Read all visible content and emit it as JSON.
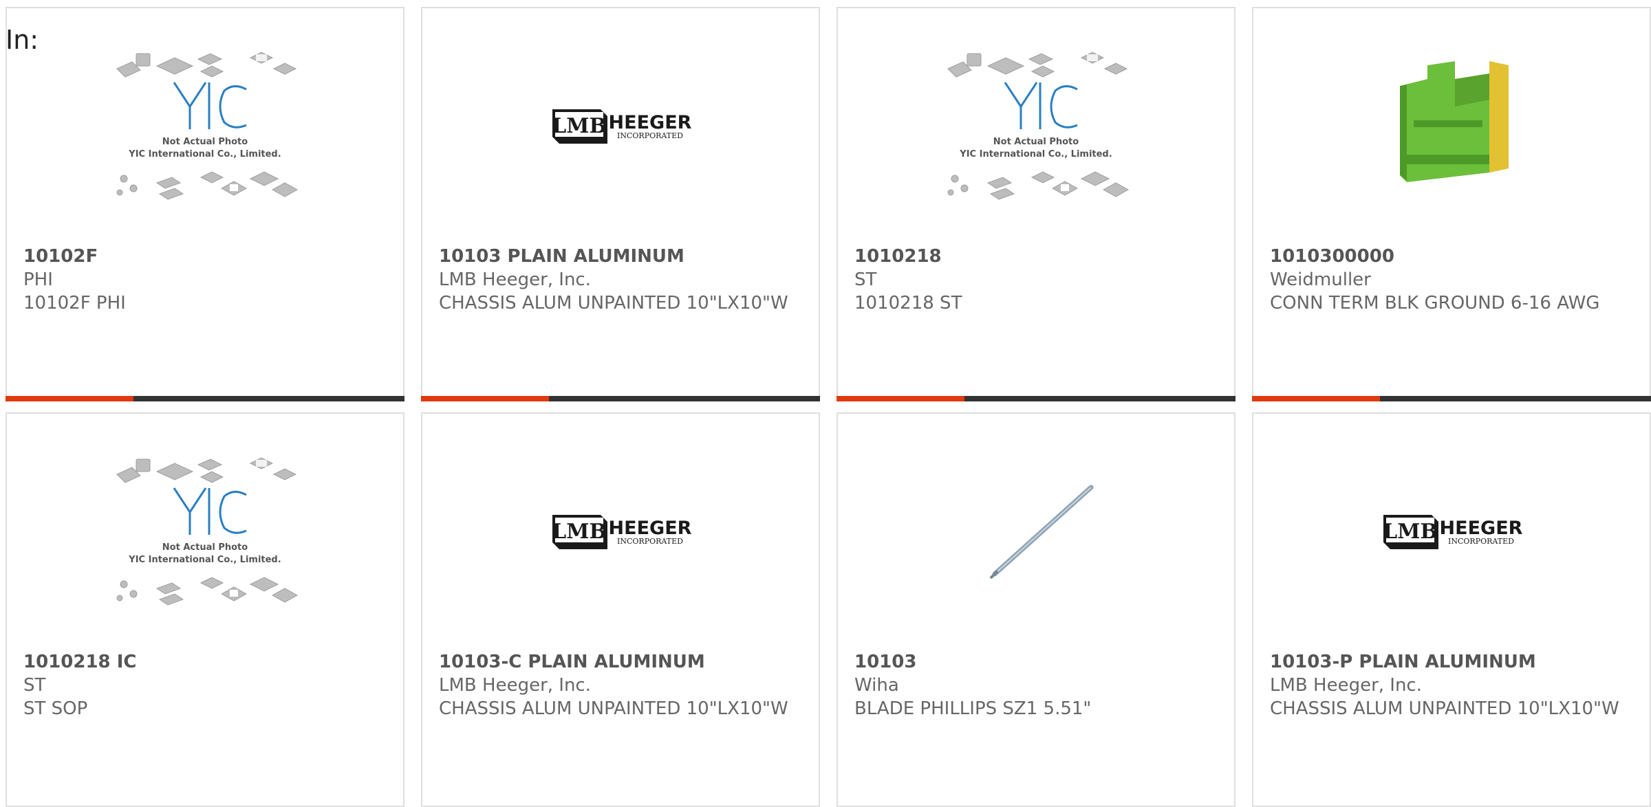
{
  "header": {
    "label": "In:"
  },
  "colors": {
    "accent": "#e03a0e",
    "bar": "#333333",
    "border": "#dedede"
  },
  "products": [
    {
      "part_number": "10102F",
      "manufacturer": "PHI",
      "description": "10102F PHI",
      "image": "yic-placeholder",
      "image_text": [
        "Not Actual Photo",
        "YIC International Co., Limited."
      ],
      "progress": 0.32
    },
    {
      "part_number": "10103 PLAIN ALUMINUM",
      "manufacturer": "LMB Heeger, Inc.",
      "description": "CHASSIS ALUM UNPAINTED 10\"LX10\"W",
      "image": "heeger-logo",
      "logo_text": [
        "LMB",
        "HEEGER",
        "INCORPORATED"
      ],
      "progress": 0.32
    },
    {
      "part_number": "1010218",
      "manufacturer": "ST",
      "description": "1010218 ST",
      "image": "yic-placeholder",
      "image_text": [
        "Not Actual Photo",
        "YIC International Co., Limited."
      ],
      "progress": 0.32
    },
    {
      "part_number": "1010300000",
      "manufacturer": "Weidmuller",
      "description": "CONN TERM BLK GROUND 6-16 AWG",
      "image": "terminal-block",
      "progress": 0.32
    },
    {
      "part_number": "1010218 IC",
      "manufacturer": "ST",
      "description": "ST SOP",
      "image": "yic-placeholder",
      "image_text": [
        "Not Actual Photo",
        "YIC International Co., Limited."
      ]
    },
    {
      "part_number": "10103-C PLAIN ALUMINUM",
      "manufacturer": "LMB Heeger, Inc.",
      "description": "CHASSIS ALUM UNPAINTED 10\"LX10\"W",
      "image": "heeger-logo",
      "logo_text": [
        "LMB",
        "HEEGER",
        "INCORPORATED"
      ]
    },
    {
      "part_number": "10103",
      "manufacturer": "Wiha",
      "description": "BLADE PHILLIPS SZ1 5.51\"",
      "image": "screwdriver-blade"
    },
    {
      "part_number": "10103-P PLAIN ALUMINUM",
      "manufacturer": "LMB Heeger, Inc.",
      "description": "CHASSIS ALUM UNPAINTED 10\"LX10\"W",
      "image": "heeger-logo",
      "logo_text": [
        "LMB",
        "HEEGER",
        "INCORPORATED"
      ]
    }
  ]
}
